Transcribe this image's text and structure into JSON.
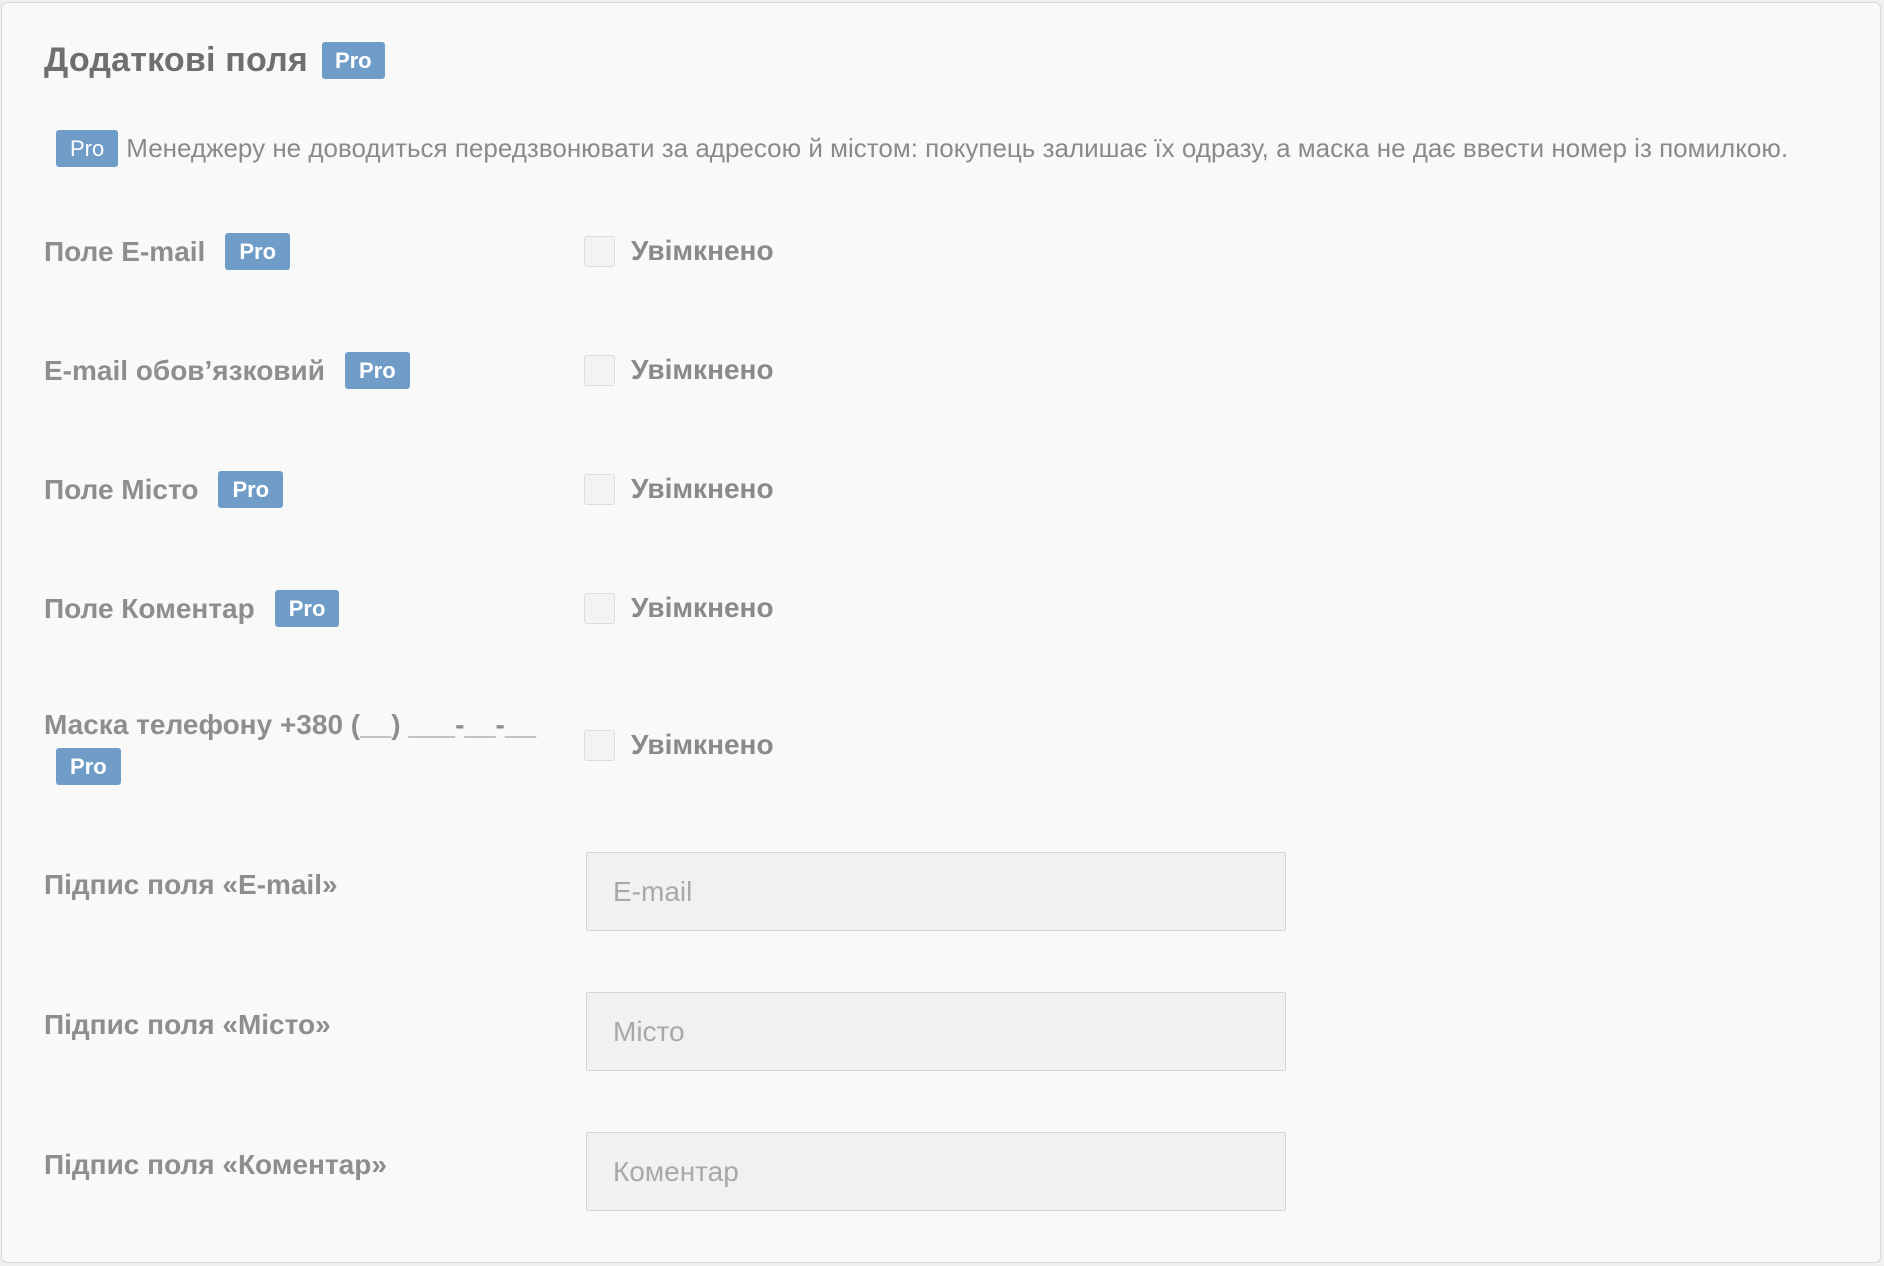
{
  "section": {
    "title": "Додаткові поля",
    "badge": "Pro"
  },
  "description": {
    "badge": "Pro",
    "text": "Менеджеру не доводиться передзвонювати за адресою й містом: покупець залишає їх одразу, а маска не дає ввести номер із помилкою."
  },
  "toggles": [
    {
      "label": "Поле E-mail",
      "badge": "Pro",
      "checkbox_label": "Увімкнено",
      "checked": false
    },
    {
      "label": "E-mail обов’язковий",
      "badge": "Pro",
      "checkbox_label": "Увімкнено",
      "checked": false
    },
    {
      "label": "Поле Місто",
      "badge": "Pro",
      "checkbox_label": "Увімкнено",
      "checked": false
    },
    {
      "label": "Поле Коментар",
      "badge": "Pro",
      "checkbox_label": "Увімкнено",
      "checked": false
    },
    {
      "label": "Маска телефону +380 (__) ___-__-__",
      "badge": "Pro",
      "checkbox_label": "Увімкнено",
      "checked": false
    }
  ],
  "inputs": [
    {
      "label": "Підпис поля «E-mail»",
      "value": "",
      "placeholder": "E-mail"
    },
    {
      "label": "Підпис поля «Місто»",
      "value": "",
      "placeholder": "Місто"
    },
    {
      "label": "Підпис поля «Коментар»",
      "value": "",
      "placeholder": "Коментар"
    }
  ],
  "colors": {
    "badge_bg": "#6f9dc8",
    "panel_bg": "#f9f9f9",
    "input_bg": "#f1f1f1"
  }
}
